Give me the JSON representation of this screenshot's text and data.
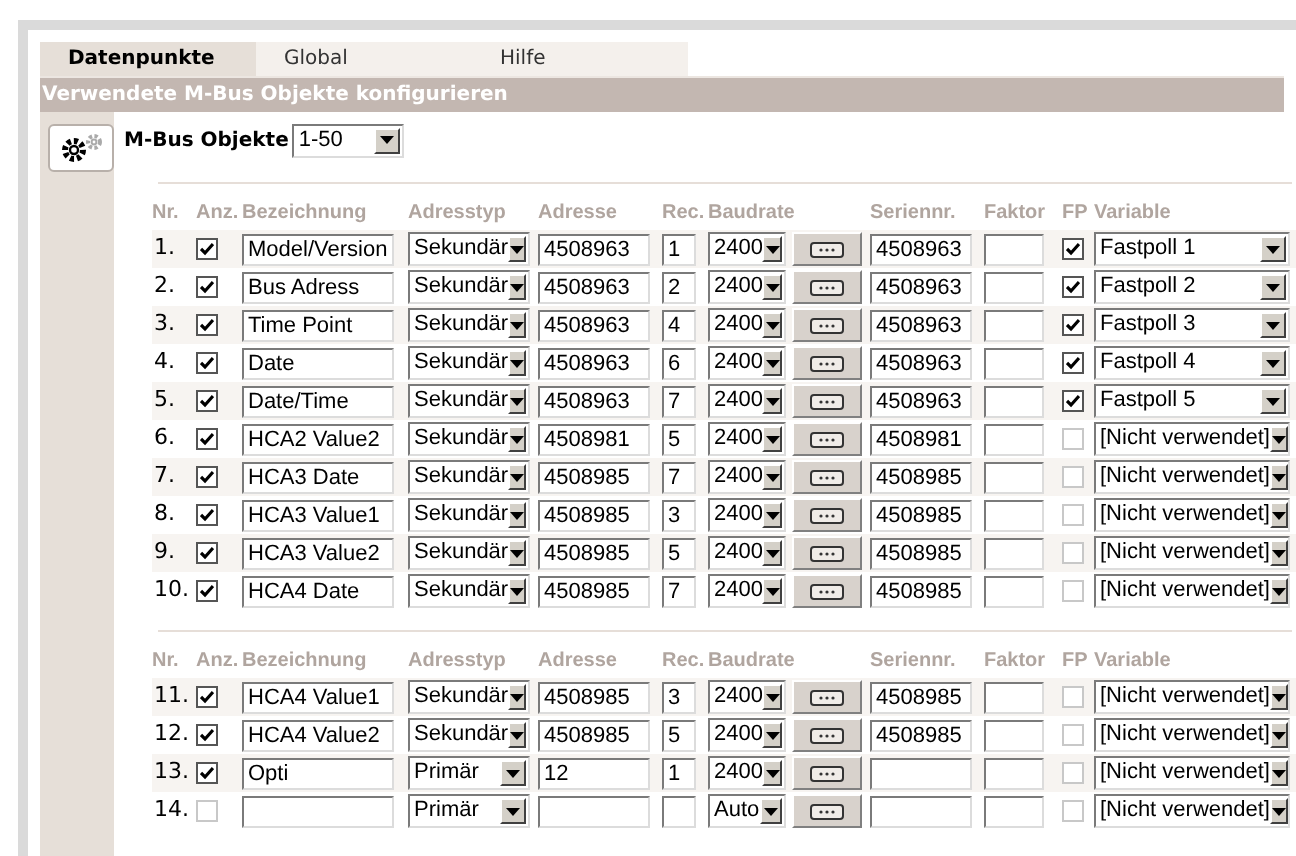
{
  "tabs": [
    {
      "label": "Datenpunkte",
      "selected": true
    },
    {
      "label": "Global",
      "selected": false
    },
    {
      "label": "Hilfe",
      "selected": false
    }
  ],
  "section_title": "Verwendete M-Bus Objekte konfigurieren",
  "objects_select": {
    "label": "M-Bus Objekte",
    "value": "1-50"
  },
  "groups": [
    {
      "columns": [
        "Nr.",
        "Anz.",
        "Bezeichnung",
        "Adresstyp",
        "Adresse",
        "Rec.",
        "Baudrate",
        "Seriennr.",
        "Faktor",
        "FP",
        "Variable"
      ],
      "rows": [
        {
          "nr": "1.",
          "shown": true,
          "name": "Model/Version",
          "address_type": "Sekundär",
          "address": "4508963",
          "rec": "1",
          "baud": "2400",
          "serial": "4508963",
          "fp": true,
          "variable": "Fastpoll 1"
        },
        {
          "nr": "2.",
          "shown": true,
          "name": "Bus Adress",
          "address_type": "Sekundär",
          "address": "4508963",
          "rec": "2",
          "baud": "2400",
          "serial": "4508963",
          "fp": true,
          "variable": "Fastpoll 2"
        },
        {
          "nr": "3.",
          "shown": true,
          "name": "Time Point",
          "address_type": "Sekundär",
          "address": "4508963",
          "rec": "4",
          "baud": "2400",
          "serial": "4508963",
          "fp": true,
          "variable": "Fastpoll 3"
        },
        {
          "nr": "4.",
          "shown": true,
          "name": "Date",
          "address_type": "Sekundär",
          "address": "4508963",
          "rec": "6",
          "baud": "2400",
          "serial": "4508963",
          "fp": true,
          "variable": "Fastpoll 4"
        },
        {
          "nr": "5.",
          "shown": true,
          "name": "Date/Time",
          "address_type": "Sekundär",
          "address": "4508963",
          "rec": "7",
          "baud": "2400",
          "serial": "4508963",
          "fp": true,
          "variable": "Fastpoll 5"
        },
        {
          "nr": "6.",
          "shown": true,
          "name": "HCA2 Value2",
          "address_type": "Sekundär",
          "address": "4508981",
          "rec": "5",
          "baud": "2400",
          "serial": "4508981",
          "fp": false,
          "variable": "[Nicht verwendet]"
        },
        {
          "nr": "7.",
          "shown": true,
          "name": "HCA3 Date",
          "address_type": "Sekundär",
          "address": "4508985",
          "rec": "7",
          "baud": "2400",
          "serial": "4508985",
          "fp": false,
          "variable": "[Nicht verwendet]"
        },
        {
          "nr": "8.",
          "shown": true,
          "name": "HCA3 Value1",
          "address_type": "Sekundär",
          "address": "4508985",
          "rec": "3",
          "baud": "2400",
          "serial": "4508985",
          "fp": false,
          "variable": "[Nicht verwendet]"
        },
        {
          "nr": "9.",
          "shown": true,
          "name": "HCA3 Value2",
          "address_type": "Sekundär",
          "address": "4508985",
          "rec": "5",
          "baud": "2400",
          "serial": "4508985",
          "fp": false,
          "variable": "[Nicht verwendet]"
        },
        {
          "nr": "10.",
          "shown": true,
          "name": "HCA4 Date",
          "address_type": "Sekundär",
          "address": "4508985",
          "rec": "7",
          "baud": "2400",
          "serial": "4508985",
          "fp": false,
          "variable": "[Nicht verwendet]"
        }
      ]
    },
    {
      "columns": [
        "Nr.",
        "Anz.",
        "Bezeichnung",
        "Adresstyp",
        "Adresse",
        "Rec.",
        "Baudrate",
        "Seriennr.",
        "Faktor",
        "FP",
        "Variable"
      ],
      "rows": [
        {
          "nr": "11.",
          "shown": true,
          "name": "HCA4 Value1",
          "address_type": "Sekundär",
          "address": "4508985",
          "rec": "3",
          "baud": "2400",
          "serial": "4508985",
          "fp": false,
          "variable": "[Nicht verwendet]"
        },
        {
          "nr": "12.",
          "shown": true,
          "name": "HCA4 Value2",
          "address_type": "Sekundär",
          "address": "4508985",
          "rec": "5",
          "baud": "2400",
          "serial": "4508985",
          "fp": false,
          "variable": "[Nicht verwendet]"
        },
        {
          "nr": "13.",
          "shown": true,
          "name": "Opti",
          "address_type": "Primär",
          "address": "12",
          "rec": "1",
          "baud": "2400",
          "fp": false,
          "variable": "[Nicht verwendet]"
        },
        {
          "nr": "14.",
          "shown": false,
          "address_type": "Primär",
          "baud": "Auto",
          "fp": false,
          "variable": "[Nicht verwendet]"
        }
      ]
    }
  ]
}
